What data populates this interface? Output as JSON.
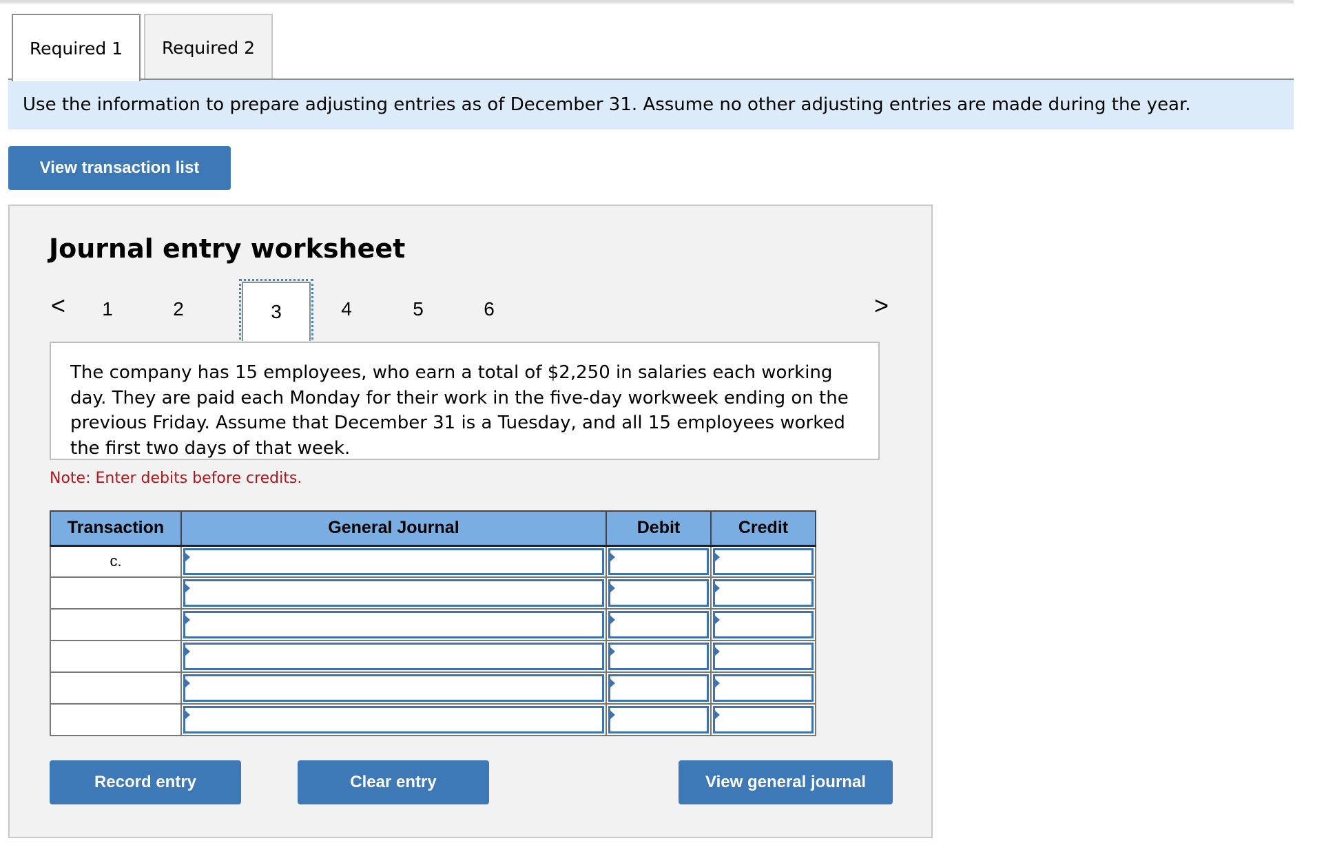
{
  "tabs": [
    {
      "label": "Required 1",
      "active": true
    },
    {
      "label": "Required 2",
      "active": false
    }
  ],
  "instruction": "Use the information to prepare adjusting entries as of December 31. Assume no other adjusting entries are made during the year.",
  "buttons": {
    "view_transaction_list": "View transaction list",
    "record_entry": "Record entry",
    "clear_entry": "Clear entry",
    "view_general_journal": "View general journal"
  },
  "worksheet": {
    "title": "Journal entry worksheet",
    "pager": {
      "prev_icon": "chevron-left-icon",
      "next_icon": "chevron-right-icon",
      "prev_glyph": "<",
      "next_glyph": ">",
      "pages": [
        "1",
        "2",
        "3",
        "4",
        "5",
        "6"
      ],
      "current": "3"
    },
    "description": "The company has 15 employees, who earn a total of $2,250 in salaries each working day. They are paid each Monday for their work in the five-day workweek ending on the previous Friday. Assume that December 31 is a Tuesday, and all 15 employees worked the first two days of that week.",
    "note": "Note: Enter debits before credits.",
    "table": {
      "headers": [
        "Transaction",
        "General Journal",
        "Debit",
        "Credit"
      ],
      "rows": [
        {
          "transaction": "c.",
          "account": "",
          "debit": "",
          "credit": ""
        },
        {
          "transaction": "",
          "account": "",
          "debit": "",
          "credit": ""
        },
        {
          "transaction": "",
          "account": "",
          "debit": "",
          "credit": ""
        },
        {
          "transaction": "",
          "account": "",
          "debit": "",
          "credit": ""
        },
        {
          "transaction": "",
          "account": "",
          "debit": "",
          "credit": ""
        },
        {
          "transaction": "",
          "account": "",
          "debit": "",
          "credit": ""
        }
      ]
    }
  },
  "colors": {
    "button_blue": "#3d78b7",
    "header_blue": "#7aaee2",
    "instruction_bg": "#dbebf9",
    "note_red": "#b0161c",
    "input_border": "#3f73ad"
  }
}
